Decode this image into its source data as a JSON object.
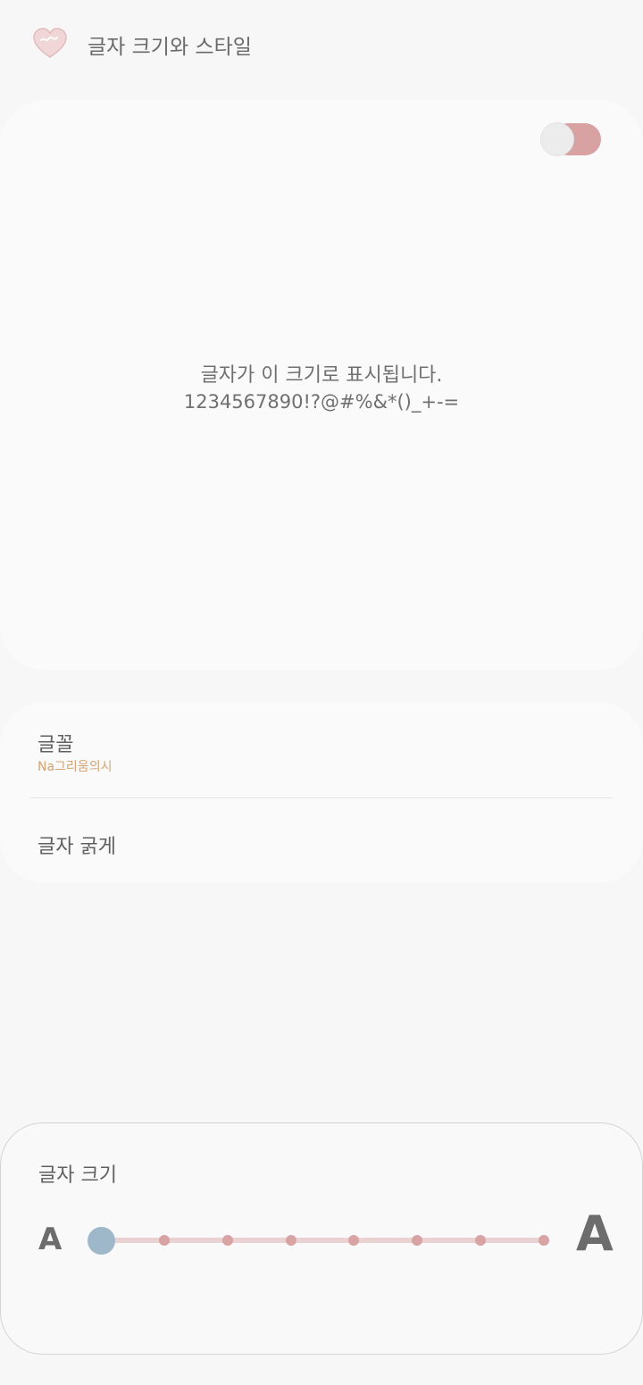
{
  "header": {
    "title": "글자 크기와 스타일",
    "icon": "heart-icon"
  },
  "preview": {
    "line1": "글자가 이 크기로 표시됩니다.",
    "line2": "1234567890!?@#%&*()_+-="
  },
  "settings": {
    "font_label": "글꼴",
    "font_value": "Na그리움의시",
    "bold_label": "글자 굵게",
    "bold_enabled": true
  },
  "font_size": {
    "label": "글자 크기",
    "small_glyph": "A",
    "large_glyph": "A",
    "steps": 8,
    "current_step": 0
  },
  "colors": {
    "accent_pink": "#d7a3a3",
    "slider_thumb": "#9eb8ca",
    "font_value": "#d4a373"
  }
}
